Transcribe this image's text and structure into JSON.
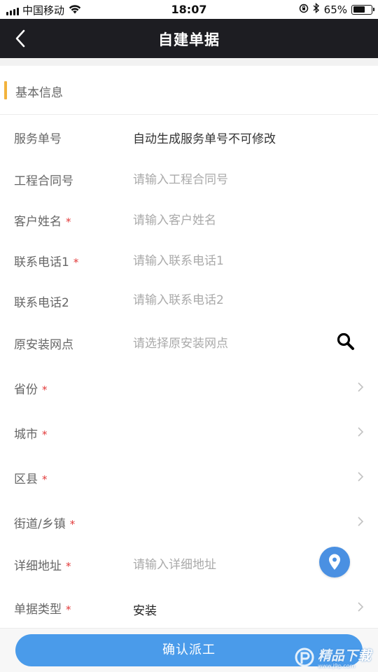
{
  "status_bar": {
    "carrier": "中国移动",
    "time": "18:07",
    "battery_percent": "65%",
    "battery_level": 0.65
  },
  "nav": {
    "title": "自建单据"
  },
  "section": {
    "title": "基本信息"
  },
  "form": {
    "service_no": {
      "label": "服务单号",
      "value": "自动生成服务单号不可修改"
    },
    "contract_no": {
      "label": "工程合同号",
      "placeholder": "请输入工程合同号"
    },
    "customer_name": {
      "label": "客户姓名",
      "placeholder": "请输入客户姓名",
      "required": "*"
    },
    "phone1": {
      "label": "联系电话1",
      "placeholder": "请输入联系电话1",
      "required": "*"
    },
    "phone2": {
      "label": "联系电话2",
      "placeholder": "请输入联系电话2"
    },
    "original_outlet": {
      "label": "原安装网点",
      "placeholder": "请选择原安装网点"
    },
    "province": {
      "label": "省份",
      "required": "*"
    },
    "city": {
      "label": "城市",
      "required": "*"
    },
    "district": {
      "label": "区县",
      "required": "*"
    },
    "street": {
      "label": "街道/乡镇",
      "required": "*"
    },
    "address": {
      "label": "详细地址",
      "placeholder": "请输入详细地址",
      "required": "*"
    },
    "order_type": {
      "label": "单据类型",
      "value": "安装",
      "required": "*"
    }
  },
  "actions": {
    "confirm_label": "确认派工"
  },
  "watermark": {
    "text": "精品下载",
    "url": "www.j9p.com"
  },
  "colors": {
    "nav_bg": "#1d1d22",
    "accent_bar": "#f2b33d",
    "primary": "#4a9bea",
    "required": "#e23a3a",
    "location_btn": "#4a90e2"
  }
}
